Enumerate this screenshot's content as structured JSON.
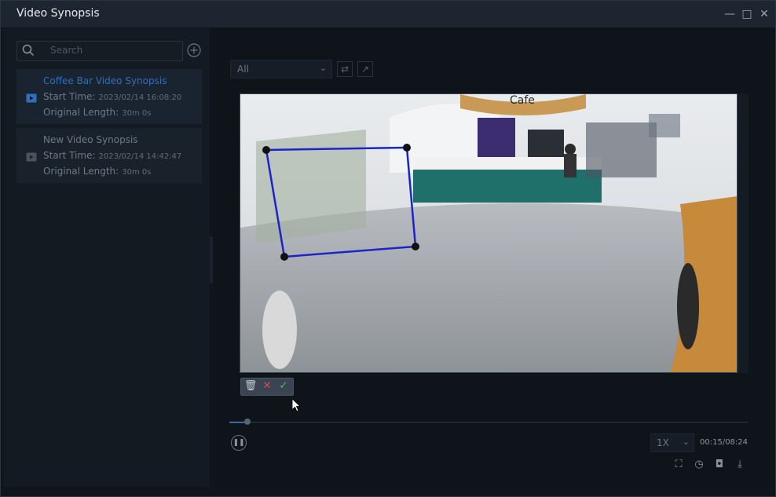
{
  "window": {
    "title": "Video Synopsis"
  },
  "sidebar": {
    "search_placeholder": "Search",
    "items": [
      {
        "name": "Coffee Bar Video Synopsis",
        "start_label": "Start Time:",
        "start_value": "2023/02/14 16:08:20",
        "length_label": "Original Length:",
        "length_value": "30m 0s",
        "selected": true
      },
      {
        "name": "New Video Synopsis",
        "start_label": "Start Time:",
        "start_value": "2023/02/14 14:42:47",
        "length_label": "Original Length:",
        "length_value": "30m 0s",
        "selected": false
      }
    ]
  },
  "main": {
    "filter_value": "All",
    "video_overlay_sign": "Cafe",
    "speed_value": "1X",
    "time_text": "00:15/08:24",
    "progress_fraction": 0.035
  },
  "colors": {
    "accent": "#2f6fbe",
    "roi_line": "#1c23c9",
    "cancel": "#e24949",
    "confirm": "#4fc05b"
  }
}
